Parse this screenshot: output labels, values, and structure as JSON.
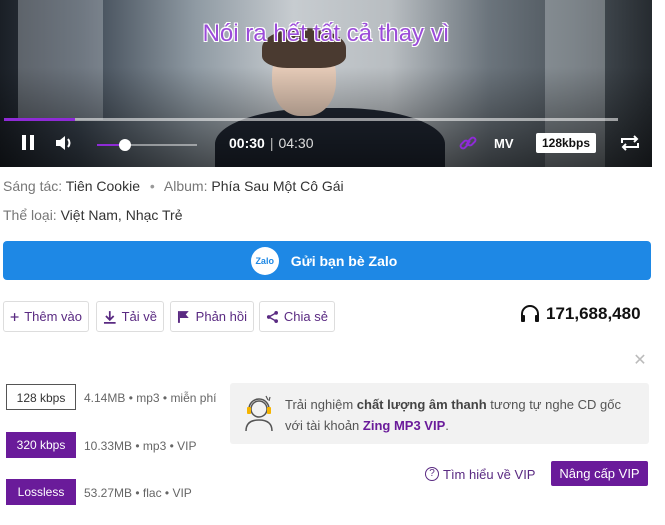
{
  "player": {
    "lyric": "Nói ra hết tất cả thay vì",
    "current_time": "00:30",
    "separator": "|",
    "duration": "04:30",
    "progress_fraction": 0.115,
    "volume_fraction": 0.28,
    "mv_label": "MV",
    "quality_label": "128kbps",
    "accent_color": "#8e2bd6"
  },
  "meta": {
    "composer_label": "Sáng tác:",
    "composer": "Tiên Cookie",
    "album_label": "Album:",
    "album": "Phía Sau Một Cô Gái",
    "genre_label": "Thể loại:",
    "genres": [
      "Việt Nam",
      "Nhạc Trẻ"
    ],
    "genre_sep": ","
  },
  "zalo": {
    "logo_text": "Zalo",
    "label": "Gửi bạn bè Zalo",
    "color": "#1e88e5"
  },
  "actions": {
    "add": "Thêm vào",
    "download": "Tải về",
    "feedback": "Phản hồi",
    "share": "Chia sẻ"
  },
  "listens": "171,688,480",
  "download_options": [
    {
      "quality": "128 kbps",
      "info": "4.14MB • mp3 • miễn phí",
      "vip": false
    },
    {
      "quality": "320 kbps",
      "info": "10.33MB • mp3 • VIP",
      "vip": true
    },
    {
      "quality": "Lossless",
      "info": "53.27MB • flac • VIP",
      "vip": true
    }
  ],
  "promo": {
    "text_before": "Trải nghiệm ",
    "text_bold": "chất lượng âm thanh",
    "text_after": " tương tự nghe CD gốc với tài khoản ",
    "brand": "Zing MP3 VIP",
    "end": "."
  },
  "learn_more": "Tìm hiểu về VIP",
  "upgrade": "Nâng cấp VIP",
  "close_icon": "close-icon",
  "vip_color": "#6a1b9a"
}
